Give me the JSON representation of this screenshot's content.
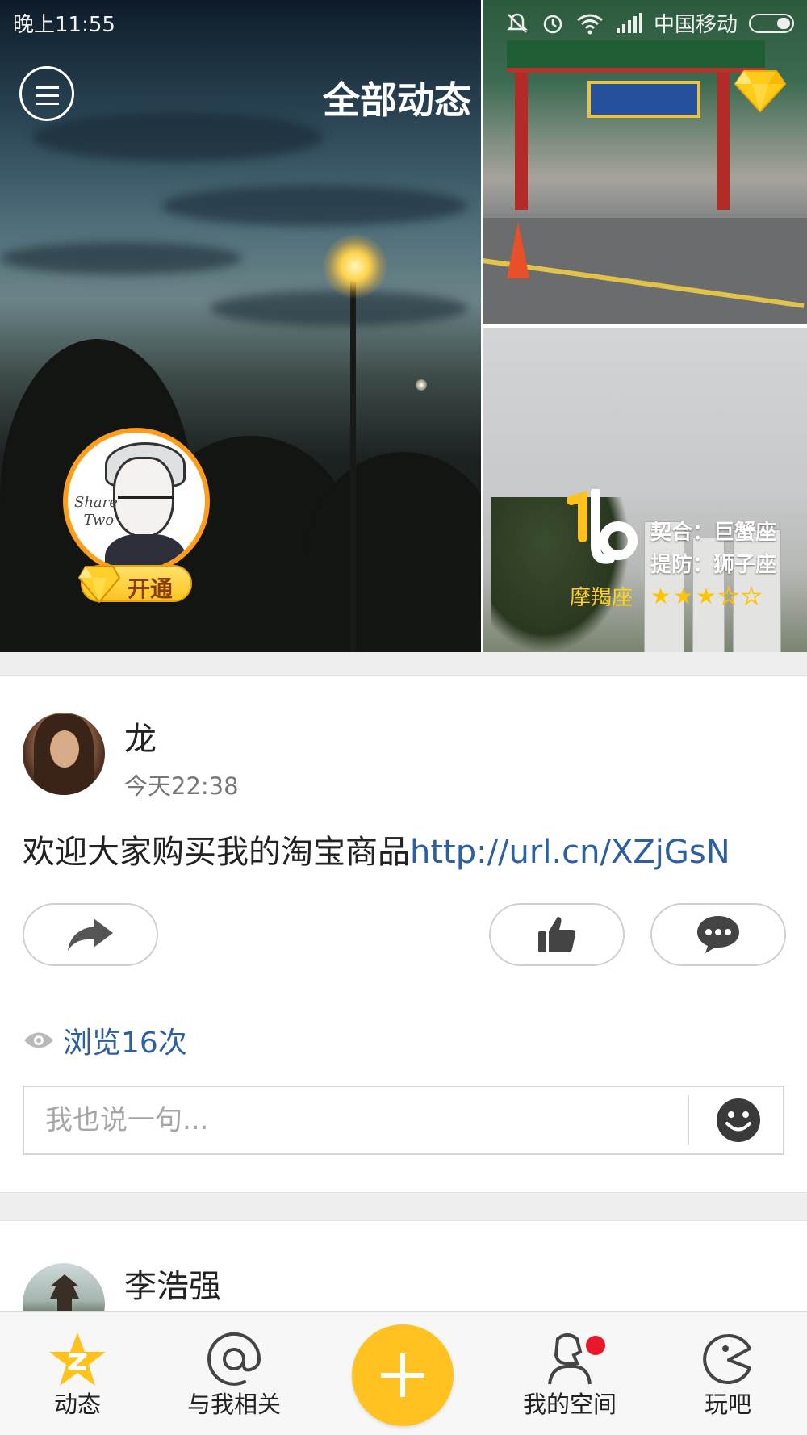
{
  "status_bar": {
    "time": "晚上11:55",
    "carrier": "中国移动",
    "icons": [
      "mute-icon",
      "alarm-icon",
      "wifi-icon",
      "signal-icon",
      "battery-icon"
    ]
  },
  "header": {
    "title": "全部动态",
    "menu_icon": "menu-icon",
    "vip_icon": "diamond-icon"
  },
  "profile": {
    "badge_label": "开通",
    "avatar_text": [
      "Share",
      "Two"
    ]
  },
  "horoscope": {
    "sign_name": "摩羯座",
    "match": "契合：巨蟹座",
    "beware": "提防：狮子座",
    "rating": 3,
    "rating_max": 5
  },
  "posts": [
    {
      "author": "龙",
      "time": "今天22:38",
      "text": "欢迎大家购买我的淘宝商品",
      "link": "http://url.cn/XZjGsN",
      "views_text": "浏览16次",
      "comment_placeholder": "我也说一句..."
    },
    {
      "author": "李浩强"
    }
  ],
  "bottom_nav": {
    "items": [
      {
        "label": "动态",
        "icon": "qzone-star-icon"
      },
      {
        "label": "与我相关",
        "icon": "at-icon"
      },
      {
        "label": "",
        "icon": "plus-icon"
      },
      {
        "label": "我的空间",
        "icon": "my-space-icon"
      },
      {
        "label": "玩吧",
        "icon": "pacman-icon"
      }
    ]
  },
  "colors": {
    "accent": "#ffc220",
    "link": "#2c5fa1",
    "badge_red": "#e8172a",
    "star": "#ffc400"
  }
}
